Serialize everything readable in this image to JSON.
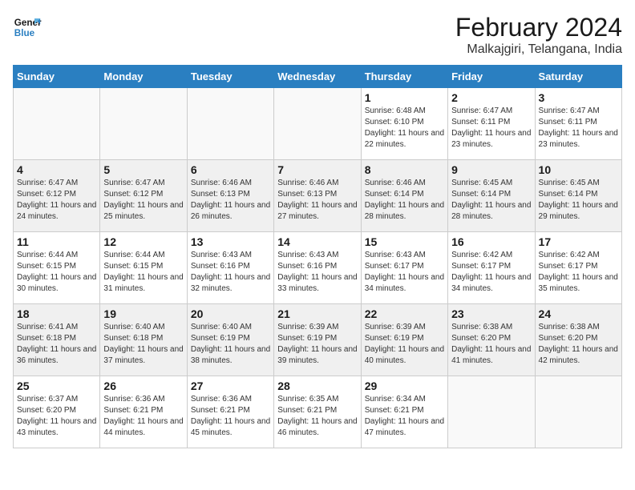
{
  "logo": {
    "line1": "General",
    "line2": "Blue"
  },
  "title": "February 2024",
  "subtitle": "Malkajgiri, Telangana, India",
  "days_of_week": [
    "Sunday",
    "Monday",
    "Tuesday",
    "Wednesday",
    "Thursday",
    "Friday",
    "Saturday"
  ],
  "weeks": [
    [
      {
        "day": "",
        "info": ""
      },
      {
        "day": "",
        "info": ""
      },
      {
        "day": "",
        "info": ""
      },
      {
        "day": "",
        "info": ""
      },
      {
        "day": "1",
        "info": "Sunrise: 6:48 AM\nSunset: 6:10 PM\nDaylight: 11 hours and 22 minutes."
      },
      {
        "day": "2",
        "info": "Sunrise: 6:47 AM\nSunset: 6:11 PM\nDaylight: 11 hours and 23 minutes."
      },
      {
        "day": "3",
        "info": "Sunrise: 6:47 AM\nSunset: 6:11 PM\nDaylight: 11 hours and 23 minutes."
      }
    ],
    [
      {
        "day": "4",
        "info": "Sunrise: 6:47 AM\nSunset: 6:12 PM\nDaylight: 11 hours and 24 minutes."
      },
      {
        "day": "5",
        "info": "Sunrise: 6:47 AM\nSunset: 6:12 PM\nDaylight: 11 hours and 25 minutes."
      },
      {
        "day": "6",
        "info": "Sunrise: 6:46 AM\nSunset: 6:13 PM\nDaylight: 11 hours and 26 minutes."
      },
      {
        "day": "7",
        "info": "Sunrise: 6:46 AM\nSunset: 6:13 PM\nDaylight: 11 hours and 27 minutes."
      },
      {
        "day": "8",
        "info": "Sunrise: 6:46 AM\nSunset: 6:14 PM\nDaylight: 11 hours and 28 minutes."
      },
      {
        "day": "9",
        "info": "Sunrise: 6:45 AM\nSunset: 6:14 PM\nDaylight: 11 hours and 28 minutes."
      },
      {
        "day": "10",
        "info": "Sunrise: 6:45 AM\nSunset: 6:14 PM\nDaylight: 11 hours and 29 minutes."
      }
    ],
    [
      {
        "day": "11",
        "info": "Sunrise: 6:44 AM\nSunset: 6:15 PM\nDaylight: 11 hours and 30 minutes."
      },
      {
        "day": "12",
        "info": "Sunrise: 6:44 AM\nSunset: 6:15 PM\nDaylight: 11 hours and 31 minutes."
      },
      {
        "day": "13",
        "info": "Sunrise: 6:43 AM\nSunset: 6:16 PM\nDaylight: 11 hours and 32 minutes."
      },
      {
        "day": "14",
        "info": "Sunrise: 6:43 AM\nSunset: 6:16 PM\nDaylight: 11 hours and 33 minutes."
      },
      {
        "day": "15",
        "info": "Sunrise: 6:43 AM\nSunset: 6:17 PM\nDaylight: 11 hours and 34 minutes."
      },
      {
        "day": "16",
        "info": "Sunrise: 6:42 AM\nSunset: 6:17 PM\nDaylight: 11 hours and 34 minutes."
      },
      {
        "day": "17",
        "info": "Sunrise: 6:42 AM\nSunset: 6:17 PM\nDaylight: 11 hours and 35 minutes."
      }
    ],
    [
      {
        "day": "18",
        "info": "Sunrise: 6:41 AM\nSunset: 6:18 PM\nDaylight: 11 hours and 36 minutes."
      },
      {
        "day": "19",
        "info": "Sunrise: 6:40 AM\nSunset: 6:18 PM\nDaylight: 11 hours and 37 minutes."
      },
      {
        "day": "20",
        "info": "Sunrise: 6:40 AM\nSunset: 6:19 PM\nDaylight: 11 hours and 38 minutes."
      },
      {
        "day": "21",
        "info": "Sunrise: 6:39 AM\nSunset: 6:19 PM\nDaylight: 11 hours and 39 minutes."
      },
      {
        "day": "22",
        "info": "Sunrise: 6:39 AM\nSunset: 6:19 PM\nDaylight: 11 hours and 40 minutes."
      },
      {
        "day": "23",
        "info": "Sunrise: 6:38 AM\nSunset: 6:20 PM\nDaylight: 11 hours and 41 minutes."
      },
      {
        "day": "24",
        "info": "Sunrise: 6:38 AM\nSunset: 6:20 PM\nDaylight: 11 hours and 42 minutes."
      }
    ],
    [
      {
        "day": "25",
        "info": "Sunrise: 6:37 AM\nSunset: 6:20 PM\nDaylight: 11 hours and 43 minutes."
      },
      {
        "day": "26",
        "info": "Sunrise: 6:36 AM\nSunset: 6:21 PM\nDaylight: 11 hours and 44 minutes."
      },
      {
        "day": "27",
        "info": "Sunrise: 6:36 AM\nSunset: 6:21 PM\nDaylight: 11 hours and 45 minutes."
      },
      {
        "day": "28",
        "info": "Sunrise: 6:35 AM\nSunset: 6:21 PM\nDaylight: 11 hours and 46 minutes."
      },
      {
        "day": "29",
        "info": "Sunrise: 6:34 AM\nSunset: 6:21 PM\nDaylight: 11 hours and 47 minutes."
      },
      {
        "day": "",
        "info": ""
      },
      {
        "day": "",
        "info": ""
      }
    ]
  ]
}
